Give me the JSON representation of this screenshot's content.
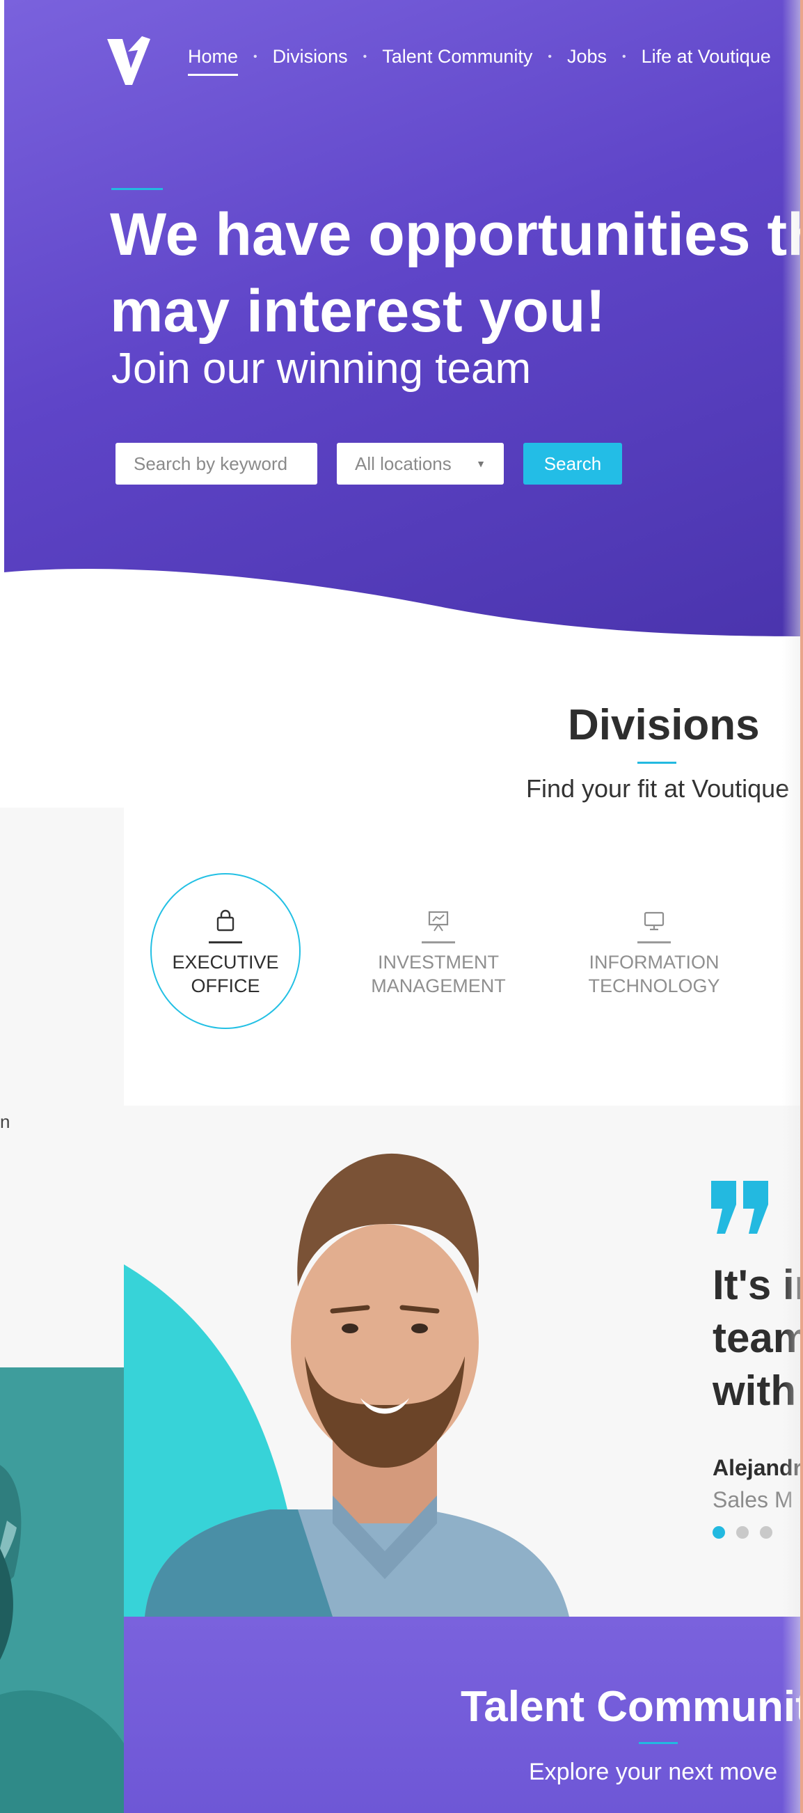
{
  "header": {
    "logo_label": "V",
    "nav": [
      {
        "label": "Home",
        "active": true
      },
      {
        "label": "Divisions",
        "active": false
      },
      {
        "label": "Talent Community",
        "active": false
      },
      {
        "label": "Jobs",
        "active": false
      },
      {
        "label": "Life at Voutique",
        "active": false
      }
    ]
  },
  "hero": {
    "title_line1": "We have opportunities th",
    "title_line2": "may interest you!",
    "subtitle": "Join our winning team",
    "search_placeholder": "Search by keyword",
    "location_value": "All locations",
    "search_button": "Search"
  },
  "divisions": {
    "title": "Divisions",
    "subtitle": "Find your fit at Voutique",
    "tabs": [
      {
        "line1": "EXECUTIVE",
        "line2": "OFFICE",
        "icon": "shopping-bag-icon",
        "active": true
      },
      {
        "line1": "INVESTMENT",
        "line2": "MANAGEMENT",
        "icon": "presentation-chart-icon",
        "active": false
      },
      {
        "line1": "INFORMATION",
        "line2": "TECHNOLOGY",
        "icon": "monitor-icon",
        "active": false
      }
    ]
  },
  "left_panel": {
    "text": "n"
  },
  "testimonial": {
    "quote": "It's ir\nteam\nwith",
    "author": "Alejandr",
    "role": "Sales M",
    "dots_count": 3,
    "active_dot": 0
  },
  "talent": {
    "title": "Talent Communiti",
    "subtitle": "Explore your next move"
  },
  "colors": {
    "hero_purple": "#6a50d2",
    "accent_cyan": "#23b9e0",
    "teal": "#35d0d6",
    "text_dark": "#2e2e2e"
  }
}
